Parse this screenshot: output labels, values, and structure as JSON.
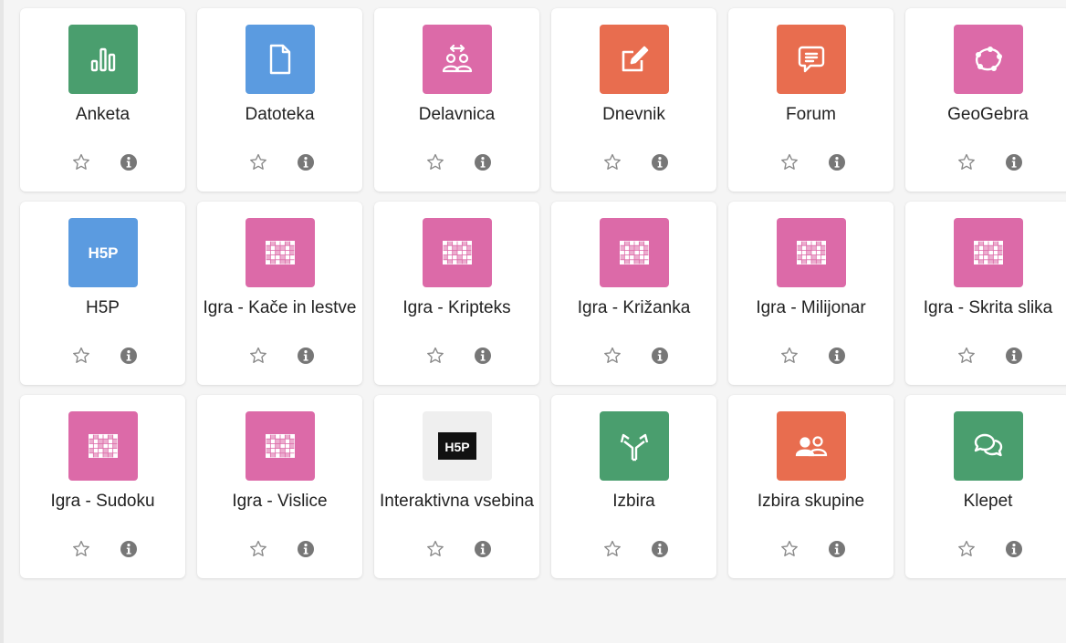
{
  "colors": {
    "green": "#4a9e6e",
    "blue": "#5b9be0",
    "pink": "#dc6aa8",
    "orange": "#e86d4f",
    "light": "#efefef",
    "star": "#8a8a8a",
    "info": "#777777"
  },
  "modules": [
    {
      "label": "Anketa",
      "icon": "chart-bars-icon",
      "color": "green"
    },
    {
      "label": "Datoteka",
      "icon": "file-icon",
      "color": "blue"
    },
    {
      "label": "Delavnica",
      "icon": "workshop-icon",
      "color": "pink"
    },
    {
      "label": "Dnevnik",
      "icon": "edit-icon",
      "color": "orange"
    },
    {
      "label": "Forum",
      "icon": "chat-bubble-icon",
      "color": "orange"
    },
    {
      "label": "GeoGebra",
      "icon": "geogebra-icon",
      "color": "pink"
    },
    {
      "label": "H5P",
      "icon": "h5p-icon",
      "color": "blue"
    },
    {
      "label": "Igra - Kače in lestve",
      "icon": "game-grid-icon",
      "color": "pink"
    },
    {
      "label": "Igra - Kripteks",
      "icon": "game-grid-icon",
      "color": "pink"
    },
    {
      "label": "Igra - Križanka",
      "icon": "game-grid-icon",
      "color": "pink"
    },
    {
      "label": "Igra - Milijonar",
      "icon": "game-grid-icon",
      "color": "pink"
    },
    {
      "label": "Igra - Skrita slika",
      "icon": "game-grid-icon",
      "color": "pink"
    },
    {
      "label": "Igra - Sudoku",
      "icon": "game-grid-icon",
      "color": "pink"
    },
    {
      "label": "Igra - Vislice",
      "icon": "game-grid-icon",
      "color": "pink"
    },
    {
      "label": "Interaktivna vsebina",
      "icon": "h5p-dark-icon",
      "color": "light"
    },
    {
      "label": "Izbira",
      "icon": "signpost-icon",
      "color": "green"
    },
    {
      "label": "Izbira skupine",
      "icon": "users-icon",
      "color": "orange"
    },
    {
      "label": "Klepet",
      "icon": "chat-icon",
      "color": "green"
    }
  ]
}
